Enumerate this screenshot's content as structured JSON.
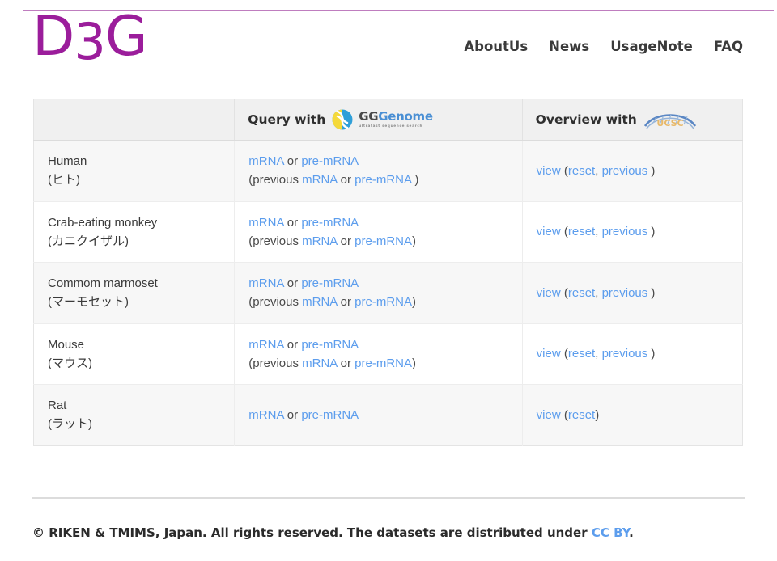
{
  "site": {
    "logo_text_part1": "D",
    "logo_text_mid": "3",
    "logo_text_part2": "G",
    "logo_color": "#9b1d9b",
    "top_rule_color": "#bf7dbf"
  },
  "nav": {
    "items": [
      {
        "label": "AboutUs"
      },
      {
        "label": "News"
      },
      {
        "label": "UsageNote"
      },
      {
        "label": "FAQ"
      }
    ]
  },
  "table": {
    "headers": {
      "species": "",
      "query": "Query with",
      "overview": "Overview with"
    },
    "gggenome_logo": {
      "word_primary": "GG",
      "word_secondary": "Genome",
      "tagline": "ultrafast sequence search",
      "primary_color": "#4a4a4a",
      "secondary_color": "#4a8fd4"
    },
    "ucsc_logo": {
      "label": "UCSC",
      "arc_color": "#5b87c4",
      "text_color": "#e8b96a"
    },
    "link_color": "#5c9ded",
    "rows": [
      {
        "species_en": "Human",
        "species_ja": "(ヒト)",
        "query_line1": [
          {
            "type": "link",
            "text": "mRNA"
          },
          {
            "type": "text",
            "text": " or "
          },
          {
            "type": "link",
            "text": "pre-mRNA"
          }
        ],
        "query_line2": [
          {
            "type": "text",
            "text": "(previous "
          },
          {
            "type": "link",
            "text": "mRNA"
          },
          {
            "type": "text",
            "text": " or "
          },
          {
            "type": "link",
            "text": "pre-mRNA"
          },
          {
            "type": "text",
            "text": " )"
          }
        ],
        "overview": [
          {
            "type": "link",
            "text": "view"
          },
          {
            "type": "text",
            "text": " ("
          },
          {
            "type": "link",
            "text": "reset"
          },
          {
            "type": "text",
            "text": ", "
          },
          {
            "type": "link",
            "text": "previous"
          },
          {
            "type": "text",
            "text": " )"
          }
        ]
      },
      {
        "species_en": "Crab-eating monkey",
        "species_ja": "(カニクイザル)",
        "query_line1": [
          {
            "type": "link",
            "text": "mRNA"
          },
          {
            "type": "text",
            "text": " or "
          },
          {
            "type": "link",
            "text": "pre-mRNA"
          }
        ],
        "query_line2": [
          {
            "type": "text",
            "text": "(previous "
          },
          {
            "type": "link",
            "text": "mRNA"
          },
          {
            "type": "text",
            "text": " or "
          },
          {
            "type": "link",
            "text": "pre-mRNA"
          },
          {
            "type": "text",
            "text": ")"
          }
        ],
        "overview": [
          {
            "type": "link",
            "text": "view"
          },
          {
            "type": "text",
            "text": " ("
          },
          {
            "type": "link",
            "text": "reset"
          },
          {
            "type": "text",
            "text": ", "
          },
          {
            "type": "link",
            "text": "previous"
          },
          {
            "type": "text",
            "text": " )"
          }
        ]
      },
      {
        "species_en": "Commom marmoset",
        "species_ja": "(マーモセット)",
        "query_line1": [
          {
            "type": "link",
            "text": "mRNA"
          },
          {
            "type": "text",
            "text": " or "
          },
          {
            "type": "link",
            "text": "pre-mRNA"
          }
        ],
        "query_line2": [
          {
            "type": "text",
            "text": "(previous "
          },
          {
            "type": "link",
            "text": "mRNA"
          },
          {
            "type": "text",
            "text": " or "
          },
          {
            "type": "link",
            "text": "pre-mRNA"
          },
          {
            "type": "text",
            "text": ")"
          }
        ],
        "overview": [
          {
            "type": "link",
            "text": "view"
          },
          {
            "type": "text",
            "text": " ("
          },
          {
            "type": "link",
            "text": "reset"
          },
          {
            "type": "text",
            "text": ", "
          },
          {
            "type": "link",
            "text": "previous"
          },
          {
            "type": "text",
            "text": " )"
          }
        ]
      },
      {
        "species_en": "Mouse",
        "species_ja": "(マウス)",
        "query_line1": [
          {
            "type": "link",
            "text": "mRNA"
          },
          {
            "type": "text",
            "text": " or "
          },
          {
            "type": "link",
            "text": "pre-mRNA"
          }
        ],
        "query_line2": [
          {
            "type": "text",
            "text": "(previous "
          },
          {
            "type": "link",
            "text": "mRNA"
          },
          {
            "type": "text",
            "text": " or "
          },
          {
            "type": "link",
            "text": "pre-mRNA"
          },
          {
            "type": "text",
            "text": ")"
          }
        ],
        "overview": [
          {
            "type": "link",
            "text": "view"
          },
          {
            "type": "text",
            "text": " ("
          },
          {
            "type": "link",
            "text": "reset"
          },
          {
            "type": "text",
            "text": ", "
          },
          {
            "type": "link",
            "text": "previous"
          },
          {
            "type": "text",
            "text": " )"
          }
        ]
      },
      {
        "species_en": "Rat",
        "species_ja": "(ラット)",
        "query_line1": [
          {
            "type": "link",
            "text": "mRNA"
          },
          {
            "type": "text",
            "text": " or "
          },
          {
            "type": "link",
            "text": "pre-mRNA"
          }
        ],
        "query_line2": [],
        "overview": [
          {
            "type": "link",
            "text": "view"
          },
          {
            "type": "text",
            "text": " ("
          },
          {
            "type": "link",
            "text": "reset"
          },
          {
            "type": "text",
            "text": ")"
          }
        ]
      }
    ]
  },
  "footer": {
    "text_before": "© RIKEN & TMIMS, Japan. All rights reserved. The datasets are distributed under ",
    "link_label": "CC BY",
    "text_after": "."
  }
}
